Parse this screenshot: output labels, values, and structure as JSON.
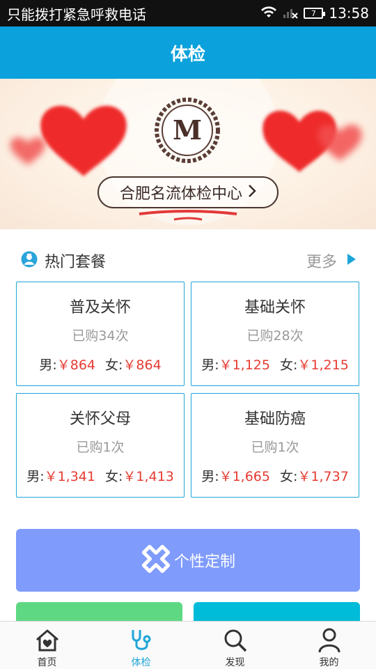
{
  "status_bar": {
    "carrier_text": "只能拨打紧急呼救电话",
    "battery_level": "7",
    "time": "13:58"
  },
  "header": {
    "title": "体检"
  },
  "banner": {
    "logo_letter": "M",
    "center_label": "合肥名流体检中心"
  },
  "hot_packages": {
    "title": "热门套餐",
    "more_label": "更多",
    "packages": [
      {
        "name": "普及关怀",
        "sold": "已购34次",
        "male_label": "男:",
        "male_price": "￥864",
        "female_label": "女:",
        "female_price": "￥864"
      },
      {
        "name": "基础关怀",
        "sold": "已购28次",
        "male_label": "男:",
        "male_price": "￥1,125",
        "female_label": "女:",
        "female_price": "￥1,215"
      },
      {
        "name": "关怀父母",
        "sold": "已购1次",
        "male_label": "男:",
        "male_price": "￥1,341",
        "female_label": "女:",
        "female_price": "￥1,413"
      },
      {
        "name": "基础防癌",
        "sold": "已购1次",
        "male_label": "男:",
        "male_price": "￥1,665",
        "female_label": "女:",
        "female_price": "￥1,737"
      }
    ]
  },
  "custom": {
    "label": "个性定制"
  },
  "tabs": [
    {
      "label": "首页",
      "icon": "home-heart-icon",
      "active": false
    },
    {
      "label": "体检",
      "icon": "stethoscope-icon",
      "active": true
    },
    {
      "label": "发现",
      "icon": "search-icon",
      "active": false
    },
    {
      "label": "我的",
      "icon": "person-icon",
      "active": false
    }
  ],
  "colors": {
    "header": "#0aa1dc",
    "accent": "#1ea5d8",
    "price": "#e53b32",
    "custom_button": "#7f9bfc",
    "tile_green": "#5fd884",
    "tile_teal": "#00bcd8"
  }
}
